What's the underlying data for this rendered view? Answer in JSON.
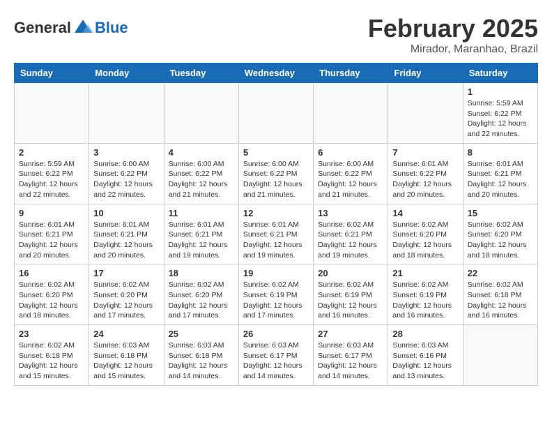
{
  "header": {
    "logo_general": "General",
    "logo_blue": "Blue",
    "title": "February 2025",
    "subtitle": "Mirador, Maranhao, Brazil"
  },
  "weekdays": [
    "Sunday",
    "Monday",
    "Tuesday",
    "Wednesday",
    "Thursday",
    "Friday",
    "Saturday"
  ],
  "weeks": [
    [
      {
        "day": "",
        "info": ""
      },
      {
        "day": "",
        "info": ""
      },
      {
        "day": "",
        "info": ""
      },
      {
        "day": "",
        "info": ""
      },
      {
        "day": "",
        "info": ""
      },
      {
        "day": "",
        "info": ""
      },
      {
        "day": "1",
        "info": "Sunrise: 5:59 AM\nSunset: 6:22 PM\nDaylight: 12 hours\nand 22 minutes."
      }
    ],
    [
      {
        "day": "2",
        "info": "Sunrise: 5:59 AM\nSunset: 6:22 PM\nDaylight: 12 hours\nand 22 minutes."
      },
      {
        "day": "3",
        "info": "Sunrise: 6:00 AM\nSunset: 6:22 PM\nDaylight: 12 hours\nand 22 minutes."
      },
      {
        "day": "4",
        "info": "Sunrise: 6:00 AM\nSunset: 6:22 PM\nDaylight: 12 hours\nand 21 minutes."
      },
      {
        "day": "5",
        "info": "Sunrise: 6:00 AM\nSunset: 6:22 PM\nDaylight: 12 hours\nand 21 minutes."
      },
      {
        "day": "6",
        "info": "Sunrise: 6:00 AM\nSunset: 6:22 PM\nDaylight: 12 hours\nand 21 minutes."
      },
      {
        "day": "7",
        "info": "Sunrise: 6:01 AM\nSunset: 6:22 PM\nDaylight: 12 hours\nand 20 minutes."
      },
      {
        "day": "8",
        "info": "Sunrise: 6:01 AM\nSunset: 6:21 PM\nDaylight: 12 hours\nand 20 minutes."
      }
    ],
    [
      {
        "day": "9",
        "info": "Sunrise: 6:01 AM\nSunset: 6:21 PM\nDaylight: 12 hours\nand 20 minutes."
      },
      {
        "day": "10",
        "info": "Sunrise: 6:01 AM\nSunset: 6:21 PM\nDaylight: 12 hours\nand 20 minutes."
      },
      {
        "day": "11",
        "info": "Sunrise: 6:01 AM\nSunset: 6:21 PM\nDaylight: 12 hours\nand 19 minutes."
      },
      {
        "day": "12",
        "info": "Sunrise: 6:01 AM\nSunset: 6:21 PM\nDaylight: 12 hours\nand 19 minutes."
      },
      {
        "day": "13",
        "info": "Sunrise: 6:02 AM\nSunset: 6:21 PM\nDaylight: 12 hours\nand 19 minutes."
      },
      {
        "day": "14",
        "info": "Sunrise: 6:02 AM\nSunset: 6:20 PM\nDaylight: 12 hours\nand 18 minutes."
      },
      {
        "day": "15",
        "info": "Sunrise: 6:02 AM\nSunset: 6:20 PM\nDaylight: 12 hours\nand 18 minutes."
      }
    ],
    [
      {
        "day": "16",
        "info": "Sunrise: 6:02 AM\nSunset: 6:20 PM\nDaylight: 12 hours\nand 18 minutes."
      },
      {
        "day": "17",
        "info": "Sunrise: 6:02 AM\nSunset: 6:20 PM\nDaylight: 12 hours\nand 17 minutes."
      },
      {
        "day": "18",
        "info": "Sunrise: 6:02 AM\nSunset: 6:20 PM\nDaylight: 12 hours\nand 17 minutes."
      },
      {
        "day": "19",
        "info": "Sunrise: 6:02 AM\nSunset: 6:19 PM\nDaylight: 12 hours\nand 17 minutes."
      },
      {
        "day": "20",
        "info": "Sunrise: 6:02 AM\nSunset: 6:19 PM\nDaylight: 12 hours\nand 16 minutes."
      },
      {
        "day": "21",
        "info": "Sunrise: 6:02 AM\nSunset: 6:19 PM\nDaylight: 12 hours\nand 16 minutes."
      },
      {
        "day": "22",
        "info": "Sunrise: 6:02 AM\nSunset: 6:18 PM\nDaylight: 12 hours\nand 16 minutes."
      }
    ],
    [
      {
        "day": "23",
        "info": "Sunrise: 6:02 AM\nSunset: 6:18 PM\nDaylight: 12 hours\nand 15 minutes."
      },
      {
        "day": "24",
        "info": "Sunrise: 6:03 AM\nSunset: 6:18 PM\nDaylight: 12 hours\nand 15 minutes."
      },
      {
        "day": "25",
        "info": "Sunrise: 6:03 AM\nSunset: 6:18 PM\nDaylight: 12 hours\nand 14 minutes."
      },
      {
        "day": "26",
        "info": "Sunrise: 6:03 AM\nSunset: 6:17 PM\nDaylight: 12 hours\nand 14 minutes."
      },
      {
        "day": "27",
        "info": "Sunrise: 6:03 AM\nSunset: 6:17 PM\nDaylight: 12 hours\nand 14 minutes."
      },
      {
        "day": "28",
        "info": "Sunrise: 6:03 AM\nSunset: 6:16 PM\nDaylight: 12 hours\nand 13 minutes."
      },
      {
        "day": "",
        "info": ""
      }
    ]
  ]
}
